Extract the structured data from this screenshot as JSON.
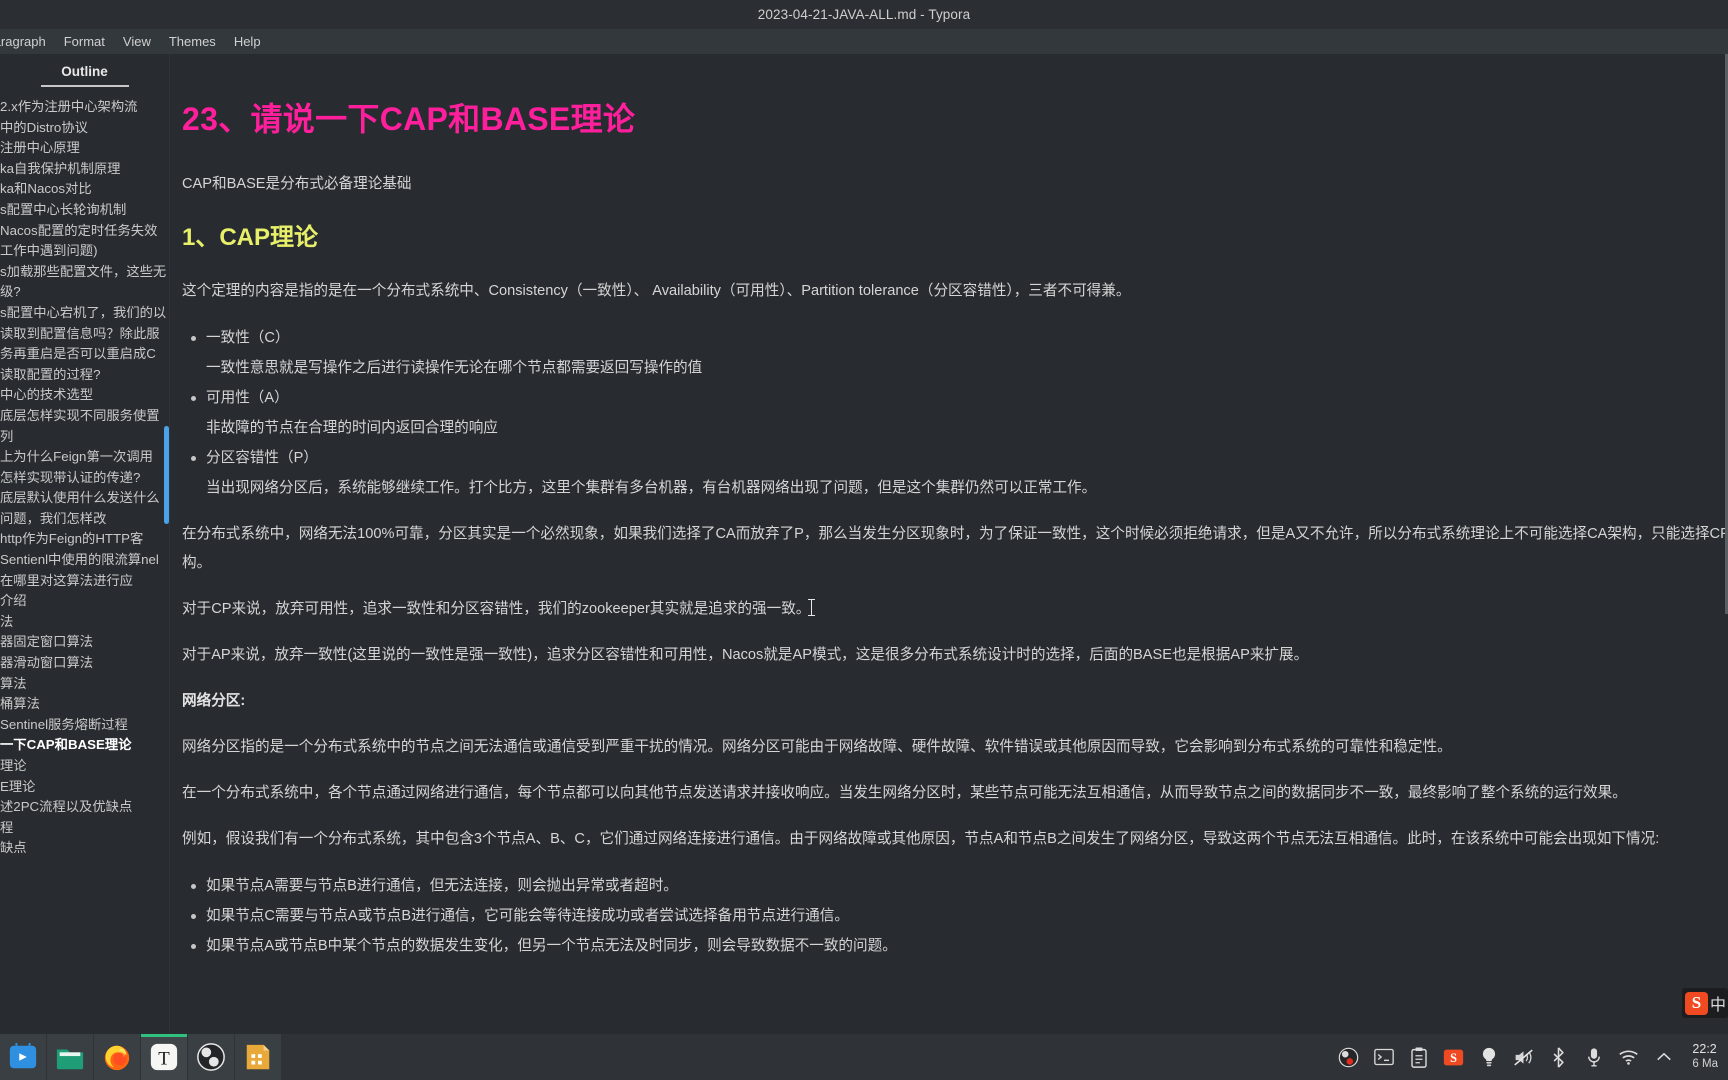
{
  "titlebar": {
    "title": "2023-04-21-JAVA-ALL.md - Typora"
  },
  "menubar": {
    "items": [
      {
        "label": "Paragraph"
      },
      {
        "label": "Format"
      },
      {
        "label": "View"
      },
      {
        "label": "Themes"
      },
      {
        "label": "Help"
      }
    ]
  },
  "sidebar": {
    "header": "Outline",
    "items": [
      {
        "label": "2.x作为注册中心架构流",
        "mode": "two"
      },
      {
        "label": "中的Distro协议",
        "mode": "one"
      },
      {
        "label": "注册中心原理",
        "mode": "one"
      },
      {
        "label": "ka自我保护机制原理",
        "mode": "one"
      },
      {
        "label": "ka和Nacos对比",
        "mode": "one"
      },
      {
        "label": "s配置中心长轮询机制",
        "mode": "one"
      },
      {
        "label": "Nacos配置的定时任务失效工作中遇到问题)",
        "mode": "two"
      },
      {
        "label": "s加载那些配置文件，这些无级?",
        "mode": "two"
      },
      {
        "label": "s配置中心宕机了，我们的以读取到配置信息吗？除此服务再重启是否可以重启成C读取配置的过程?",
        "mode": "two"
      },
      {
        "label": "中心的技术选型",
        "mode": "one"
      },
      {
        "label": "底层怎样实现不同服务使置",
        "mode": "two"
      },
      {
        "label": "列",
        "mode": "one"
      },
      {
        "label": "上为什么Feign第一次调用",
        "mode": "two"
      },
      {
        "label": "怎样实现带认证的传递?",
        "mode": "one"
      },
      {
        "label": "底层默认使用什么发送什么问题，我们怎样改",
        "mode": "two"
      },
      {
        "label": "http作为Feign的HTTP客",
        "mode": "two"
      },
      {
        "label": "Sentienl中使用的限流算nel在哪里对这算法进行应",
        "mode": "two"
      },
      {
        "label": "介绍",
        "mode": "one"
      },
      {
        "label": "法",
        "mode": "one"
      },
      {
        "label": "器固定窗口算法",
        "mode": "one"
      },
      {
        "label": "器滑动窗口算法",
        "mode": "one"
      },
      {
        "label": "算法",
        "mode": "one"
      },
      {
        "label": "桶算法",
        "mode": "one"
      },
      {
        "label": "Sentinel服务熔断过程",
        "mode": "one"
      },
      {
        "label": "一下CAP和BASE理论",
        "mode": "one",
        "active": true
      },
      {
        "label": "理论",
        "mode": "one"
      },
      {
        "label": "E理论",
        "mode": "one"
      },
      {
        "label": "述2PC流程以及优缺点",
        "mode": "one"
      },
      {
        "label": "程",
        "mode": "one"
      },
      {
        "label": "缺点",
        "mode": "one"
      }
    ]
  },
  "document": {
    "h1": "23、请说一下CAP和BASE理论",
    "intro": "CAP和BASE是分布式必备理论基础",
    "h2": "1、CAP理论",
    "p_theorem": "这个定理的内容是指的是在一个分布式系统中、Consistency（一致性）、 Availability（可用性）、Partition tolerance（分区容错性），三者不可得兼。",
    "bullets": [
      {
        "term": "一致性（C）",
        "desc": "一致性意思就是写操作之后进行读操作无论在哪个节点都需要返回写操作的值"
      },
      {
        "term": "可用性（A）",
        "desc": "非故障的节点在合理的时间内返回合理的响应"
      },
      {
        "term": "分区容错性（P）",
        "desc": "当出现网络分区后，系统能够继续工作。打个比方，这里个集群有多台机器，有台机器网络出现了问题，但是这个集群仍然可以正常工作。"
      }
    ],
    "p_dist": "在分布式系统中，网络无法100%可靠，分区其实是一个必然现象，如果我们选择了CA而放弃了P，那么当发生分区现象时，为了保证一致性，这个时候必须拒绝请求，但是A又不允许，所以分布式系统理论上不可能选择CA架构，只能选择CP或者AP架构。",
    "p_cp": "对于CP来说，放弃可用性，追求一致性和分区容错性，我们的zookeeper其实就是追求的强一致。",
    "p_ap": "对于AP来说，放弃一致性(这里说的一致性是强一致性)，追求分区容错性和可用性，Nacos就是AP模式，这是很多分布式系统设计时的选择，后面的BASE也是根据AP来扩展。",
    "h3_partition": "网络分区:",
    "p_partition1": "网络分区指的是一个分布式系统中的节点之间无法通信或通信受到严重干扰的情况。网络分区可能由于网络故障、硬件故障、软件错误或其他原因而导致，它会影响到分布式系统的可靠性和稳定性。",
    "p_partition2": "在一个分布式系统中，各个节点通过网络进行通信，每个节点都可以向其他节点发送请求并接收响应。当发生网络分区时，某些节点可能无法互相通信，从而导致节点之间的数据同步不一致，最终影响了整个系统的运行效果。",
    "p_example": "例如，假设我们有一个分布式系统，其中包含3个节点A、B、C，它们通过网络连接进行通信。由于网络故障或其他原因，节点A和节点B之间发生了网络分区，导致这两个节点无法互相通信。此时，在该系统中可能会出现如下情况:",
    "case_bullets": [
      "如果节点A需要与节点B进行通信，但无法连接，则会抛出异常或者超时。",
      "如果节点C需要与节点A或节点B进行通信，它可能会等待连接成功或者尝试选择备用节点进行通信。",
      "如果节点A或节点B中某个节点的数据发生变化，但另一个节点无法及时同步，则会导致数据不一致的问题。"
    ]
  },
  "statusbar": {
    "prev_icon": "chevron-left-icon",
    "source_icon": "source-code-icon"
  },
  "ime": {
    "logo": "S",
    "mode": "中"
  },
  "taskbar": {
    "launchers": [
      {
        "name": "app-store",
        "label": "App Store"
      },
      {
        "name": "file-manager",
        "label": "Files"
      },
      {
        "name": "firefox",
        "label": "Firefox"
      },
      {
        "name": "typora",
        "label": "Typora",
        "active": true
      },
      {
        "name": "obs-studio",
        "label": "OBS Studio"
      },
      {
        "name": "calculator",
        "label": "Calculator"
      }
    ],
    "tray": [
      {
        "name": "obs-tray-icon"
      },
      {
        "name": "terminal-icon"
      },
      {
        "name": "clipboard-icon"
      },
      {
        "name": "sogou-ime-icon"
      },
      {
        "name": "bulb-icon"
      },
      {
        "name": "volume-muted-icon"
      },
      {
        "name": "bluetooth-icon"
      },
      {
        "name": "microphone-icon"
      },
      {
        "name": "wifi-icon"
      },
      {
        "name": "show-hidden-icons"
      }
    ],
    "clock_time": "22:2",
    "clock_date": "6 Ma"
  },
  "colors": {
    "h1": "#ff1f9c",
    "h2": "#e8f06a",
    "accent_scroll": "#4aa3e8",
    "taskbar_active": "#2ec27e",
    "background": "#282c30"
  }
}
